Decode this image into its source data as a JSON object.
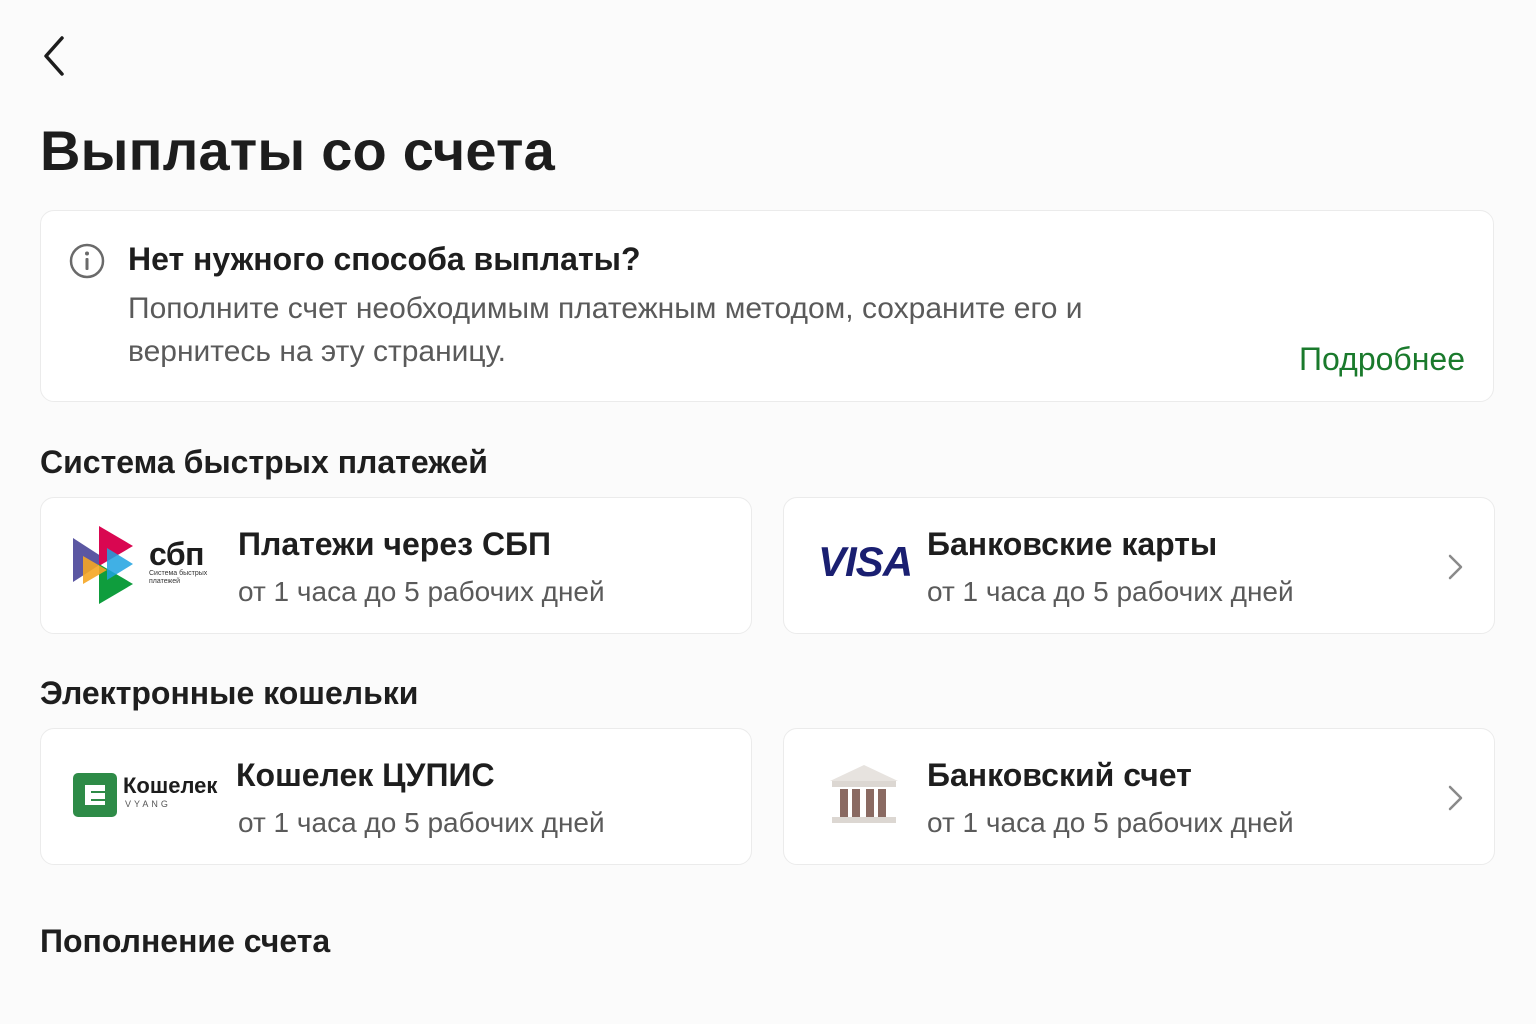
{
  "header": {
    "title": "Выплаты со счета"
  },
  "info": {
    "title": "Нет нужного способа выплаты?",
    "text": "Пополните счет необходимым платежным методом, сохраните его и вернитесь на эту страницу.",
    "link": "Подробнее"
  },
  "sections": {
    "fast_payments": "Система быстрых платежей",
    "ewallets": "Электронные кошельки",
    "topup": "Пополнение счета"
  },
  "methods": [
    {
      "name": "Платежи через СБП",
      "time": "от 1 часа до 5 рабочих дней",
      "logo_text": "сбп",
      "logo_sub": "Система быстрых платежей",
      "logo_icon": "sbp-logo"
    },
    {
      "name": "Банковские карты",
      "time": "от 1 часа до 5 рабочих дней",
      "logo_text": "VISA",
      "logo_icon": "visa-logo"
    },
    {
      "name": "Кошелек ЦУПИС",
      "time": "от 1 часа до 5 рабочих дней",
      "logo_text": "Кошелек",
      "logo_sub": "VYANG",
      "logo_icon": "wallet-logo"
    },
    {
      "name": "Банковский счет",
      "time": "от 1 часа до 5 рабочих дней",
      "logo_icon": "bank-icon"
    }
  ],
  "colors": {
    "accent": "#1a7a2c",
    "background": "#fbfbfb",
    "card": "#ffffff",
    "text": "#1e1e1e",
    "muted": "#5a5a5a",
    "visa": "#1a1f71",
    "wallet_green": "#2e8b47"
  }
}
